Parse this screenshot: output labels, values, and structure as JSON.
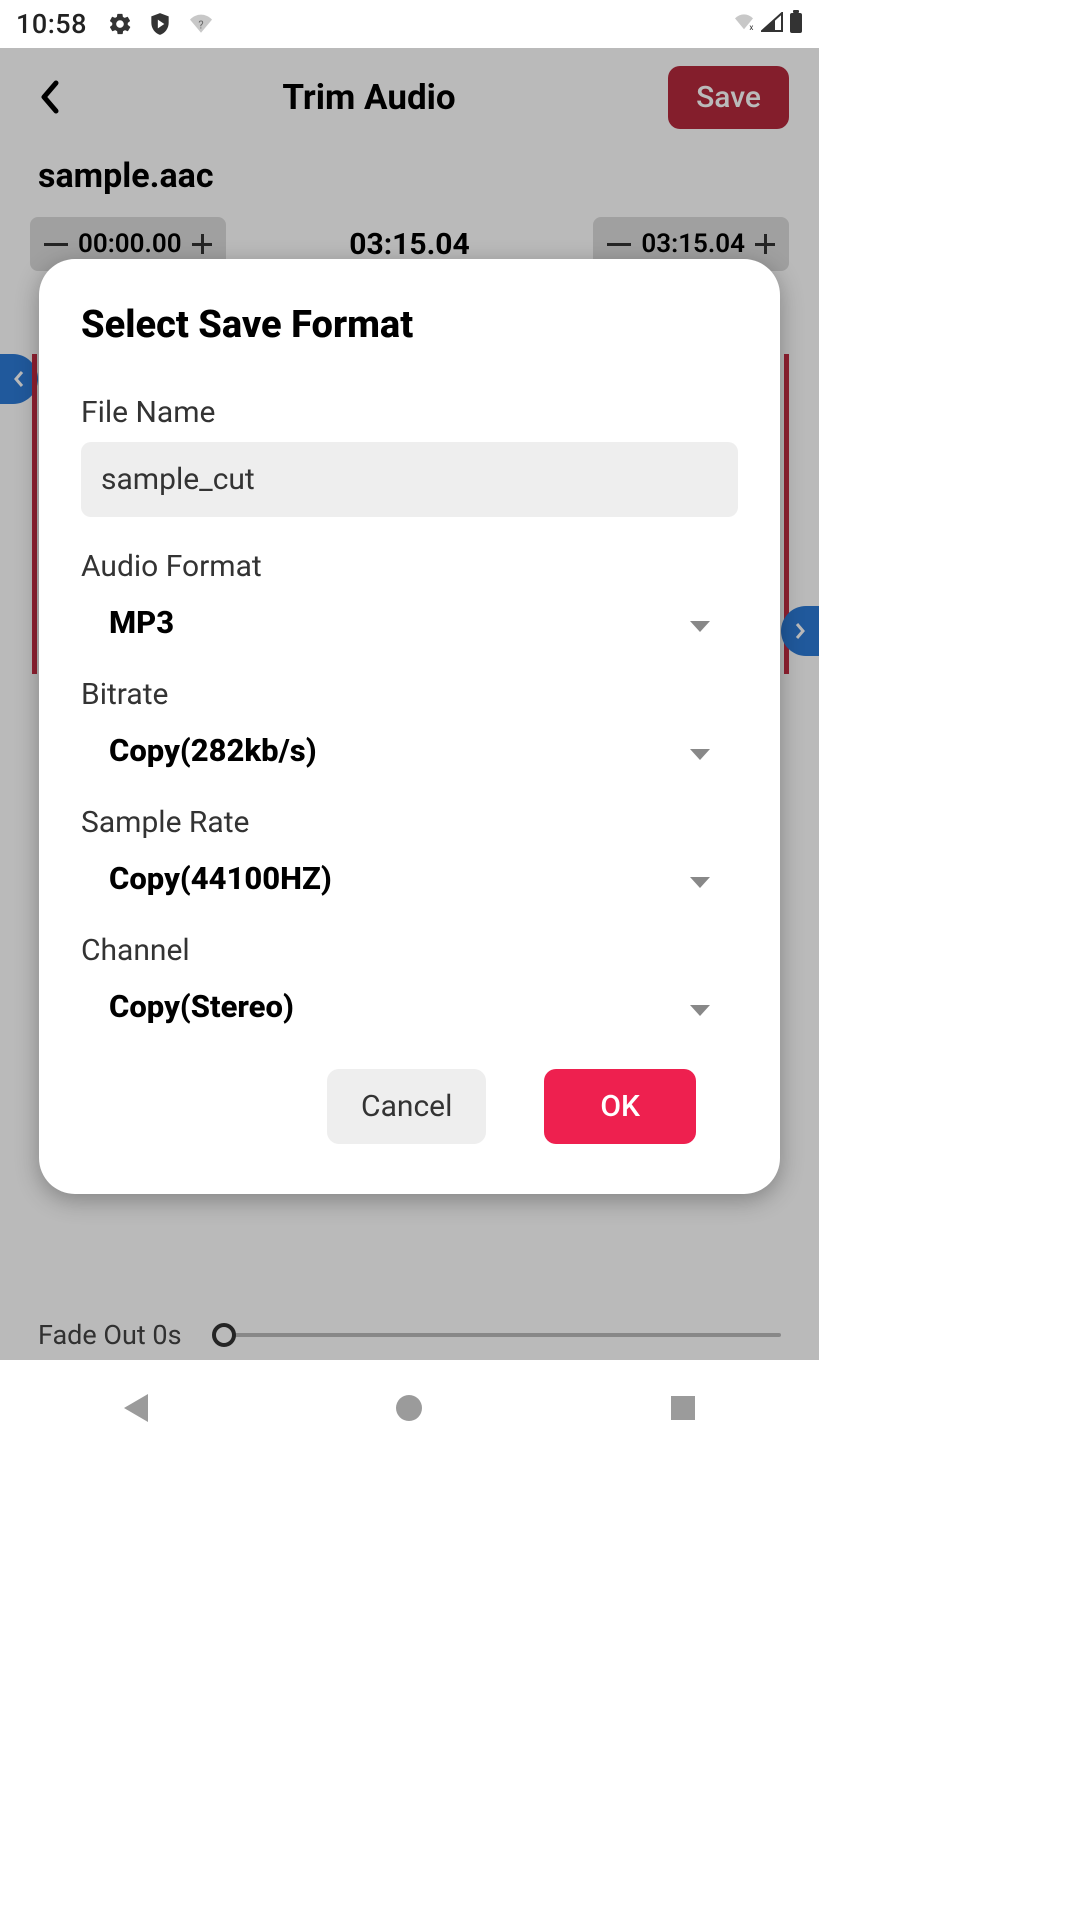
{
  "statusbar": {
    "time": "10:58"
  },
  "header": {
    "title": "Trim Audio",
    "save_label": "Save"
  },
  "file": {
    "name": "sample.aac"
  },
  "times": {
    "start": "00:00.00",
    "duration": "03:15.04",
    "end": "03:15.04"
  },
  "fade": {
    "label": "Fade Out 0s"
  },
  "dialog": {
    "title": "Select Save Format",
    "file_name_label": "File Name",
    "file_name_value": "sample_cut",
    "audio_format_label": "Audio Format",
    "audio_format_value": "MP3",
    "bitrate_label": "Bitrate",
    "bitrate_value": "Copy(282kb/s)",
    "sample_rate_label": "Sample Rate",
    "sample_rate_value": "Copy(44100HZ)",
    "channel_label": "Channel",
    "channel_value": "Copy(Stereo)",
    "cancel_label": "Cancel",
    "ok_label": "OK"
  },
  "colors": {
    "accent": "#ee204f",
    "save": "#b52a3d",
    "blue": "#2c7ad6"
  }
}
